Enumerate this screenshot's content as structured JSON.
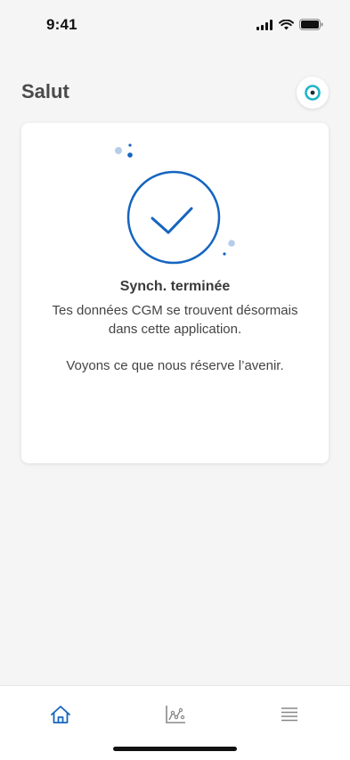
{
  "status_bar": {
    "time": "9:41"
  },
  "header": {
    "title": "Salut"
  },
  "card": {
    "title": "Synch. terminée",
    "body_line1": "Tes données CGM se trouvent désormais dans cette application.",
    "body_line2": "Voyons ce que nous réserve l’avenir."
  },
  "tab_bar": {
    "tabs": [
      {
        "icon": "home-icon",
        "selected": true
      },
      {
        "icon": "chart-icon",
        "selected": false
      },
      {
        "icon": "menu-icon",
        "selected": false
      }
    ]
  },
  "colors": {
    "accent": "#1565c0",
    "sensor": "#1fb5c7",
    "background": "#f5f5f5"
  }
}
